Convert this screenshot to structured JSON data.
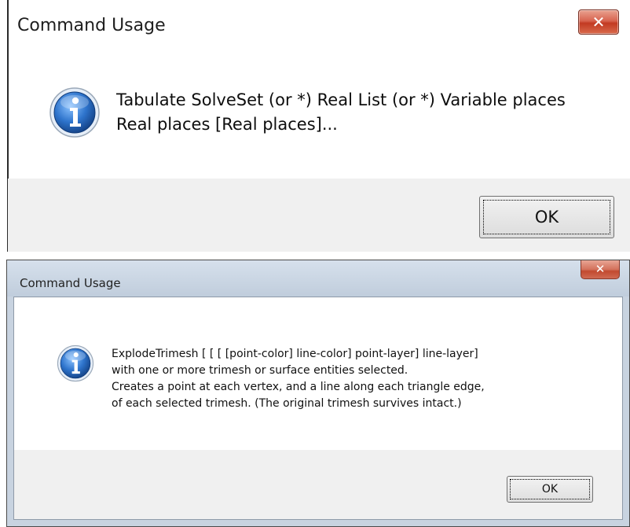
{
  "dialogs": [
    {
      "title": "Command Usage",
      "close_symbol": "✕",
      "icon": "info-icon",
      "message": "Tabulate SolveSet (or *) Real List (or *) Variable places\nReal places [Real places]...",
      "ok_label": "OK"
    },
    {
      "title": "Command Usage",
      "close_symbol": "✕",
      "icon": "info-icon",
      "message": "ExplodeTrimesh [ [ [ [point-color] line-color] point-layer] line-layer]\nwith one or more trimesh or surface entities selected.\nCreates a point at each vertex, and a line along each triangle edge,\nof each selected trimesh. (The original trimesh survives intact.)",
      "ok_label": "OK"
    }
  ],
  "colors": {
    "close_button": "#c74a34",
    "info_icon": "#1f5fb0",
    "footer": "#f0f0f0",
    "titlebar": "#c8d3e0"
  }
}
